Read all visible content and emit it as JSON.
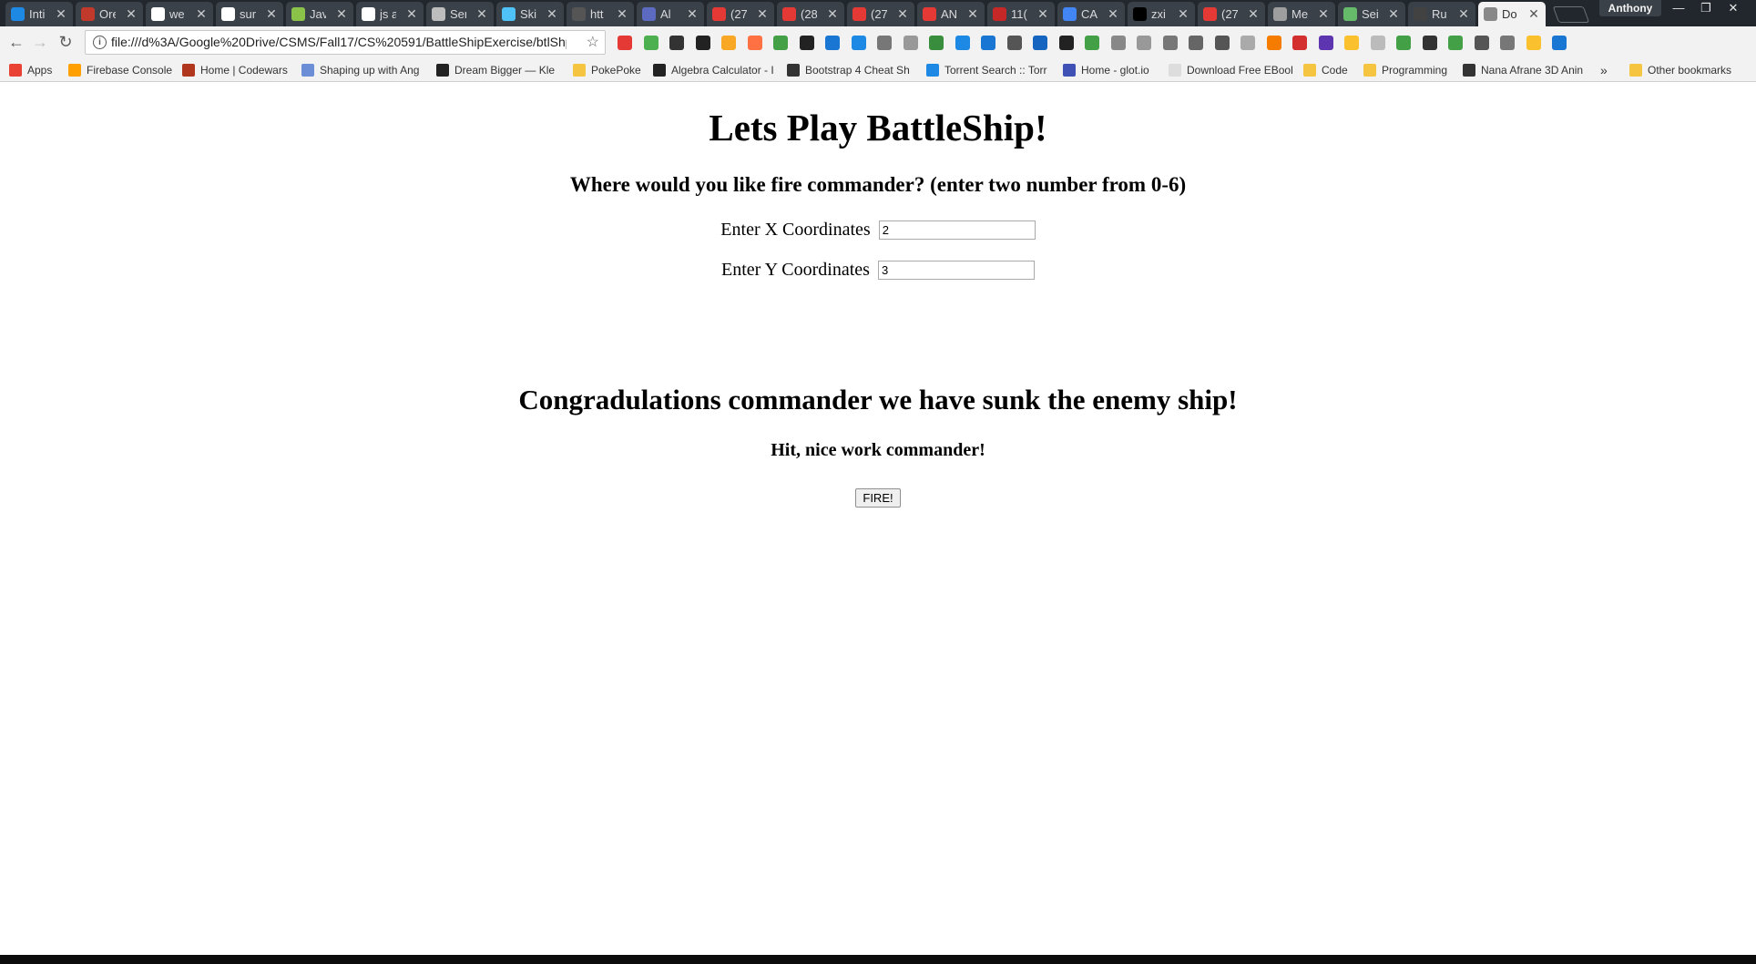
{
  "browser": {
    "tabs": [
      {
        "title": "Inti",
        "icon": "y-icon",
        "color": "#1e88e5"
      },
      {
        "title": "Ore",
        "icon": "recipe-icon",
        "color": "#c0392b"
      },
      {
        "title": "we",
        "icon": "google-icon",
        "color": "#ffffff"
      },
      {
        "title": "sur",
        "icon": "google-icon",
        "color": "#ffffff"
      },
      {
        "title": "Jav",
        "icon": "codewars-icon",
        "color": "#8bc34a"
      },
      {
        "title": "js a",
        "icon": "google-icon",
        "color": "#ffffff"
      },
      {
        "title": "Ser",
        "icon": "w-icon",
        "color": "#bdbdbd"
      },
      {
        "title": "Ski",
        "icon": "angular-icon",
        "color": "#4fc3f7"
      },
      {
        "title": "htt",
        "icon": "page-icon",
        "color": "#555555"
      },
      {
        "title": "Al",
        "icon": "k-icon",
        "color": "#5c6bc0"
      },
      {
        "title": "(27",
        "icon": "youtube-icon",
        "color": "#e53935"
      },
      {
        "title": "(28",
        "icon": "youtube-icon",
        "color": "#e53935"
      },
      {
        "title": "(27",
        "icon": "youtube-icon",
        "color": "#e53935"
      },
      {
        "title": "AN",
        "icon": "gmail-icon",
        "color": "#e53935"
      },
      {
        "title": "11(",
        "icon": "alert-icon",
        "color": "#c62828"
      },
      {
        "title": "CA",
        "icon": "docs-icon",
        "color": "#4285f4"
      },
      {
        "title": "zxi",
        "icon": "github-icon",
        "color": "#000000"
      },
      {
        "title": "(27",
        "icon": "youtube-icon",
        "color": "#e53935"
      },
      {
        "title": "Me",
        "icon": "chart-icon",
        "color": "#9e9e9e"
      },
      {
        "title": "Sei",
        "icon": "seed-icon",
        "color": "#66bb6a"
      },
      {
        "title": "Ru",
        "icon": "dark-icon",
        "color": "#424242"
      },
      {
        "title": "Do",
        "icon": "page-icon",
        "color": "#888888",
        "active": true
      }
    ],
    "profile_name": "Anthony",
    "url": "file:///d%3A/Google%20Drive/CSMS/Fall17/CS%20591/BattleShipExercise/btlShp....",
    "bookmarks": [
      {
        "label": "Apps",
        "icon": "apps-icon"
      },
      {
        "label": "Firebase Console",
        "icon": "firebase-icon"
      },
      {
        "label": "Home | Codewars",
        "icon": "codewars-icon"
      },
      {
        "label": "Shaping up with Ang",
        "icon": "code-icon"
      },
      {
        "label": "Dream Bigger — Kle",
        "icon": "kpcb-icon"
      },
      {
        "label": "PokePoke",
        "icon": "folder-icon"
      },
      {
        "label": "Algebra Calculator - I",
        "icon": "calculator-icon"
      },
      {
        "label": "Bootstrap 4 Cheat Sh",
        "icon": "bootstrap-icon"
      },
      {
        "label": "Torrent Search :: Torr",
        "icon": "torrent-icon"
      },
      {
        "label": "Home - glot.io",
        "icon": "glot-icon"
      },
      {
        "label": "Download Free EBool",
        "icon": "page-icon"
      },
      {
        "label": "Code",
        "icon": "folder-icon"
      },
      {
        "label": "Programming",
        "icon": "folder-icon"
      },
      {
        "label": "Nana Afrane 3D Anin",
        "icon": "figure-icon"
      }
    ],
    "bookmarks_overflow": "»",
    "other_bookmarks": "Other bookmarks"
  },
  "game": {
    "title": "Lets Play BattleShip!",
    "prompt": "Where would you like fire commander? (enter two number from 0-6)",
    "x_label": "Enter X Coordinates",
    "x_value": "2",
    "y_label": "Enter Y Coordinates",
    "y_value": "3",
    "result": "Congradulations commander we have sunk the enemy ship!",
    "hit_message": "Hit, nice work commander!",
    "fire_label": "FIRE!"
  }
}
